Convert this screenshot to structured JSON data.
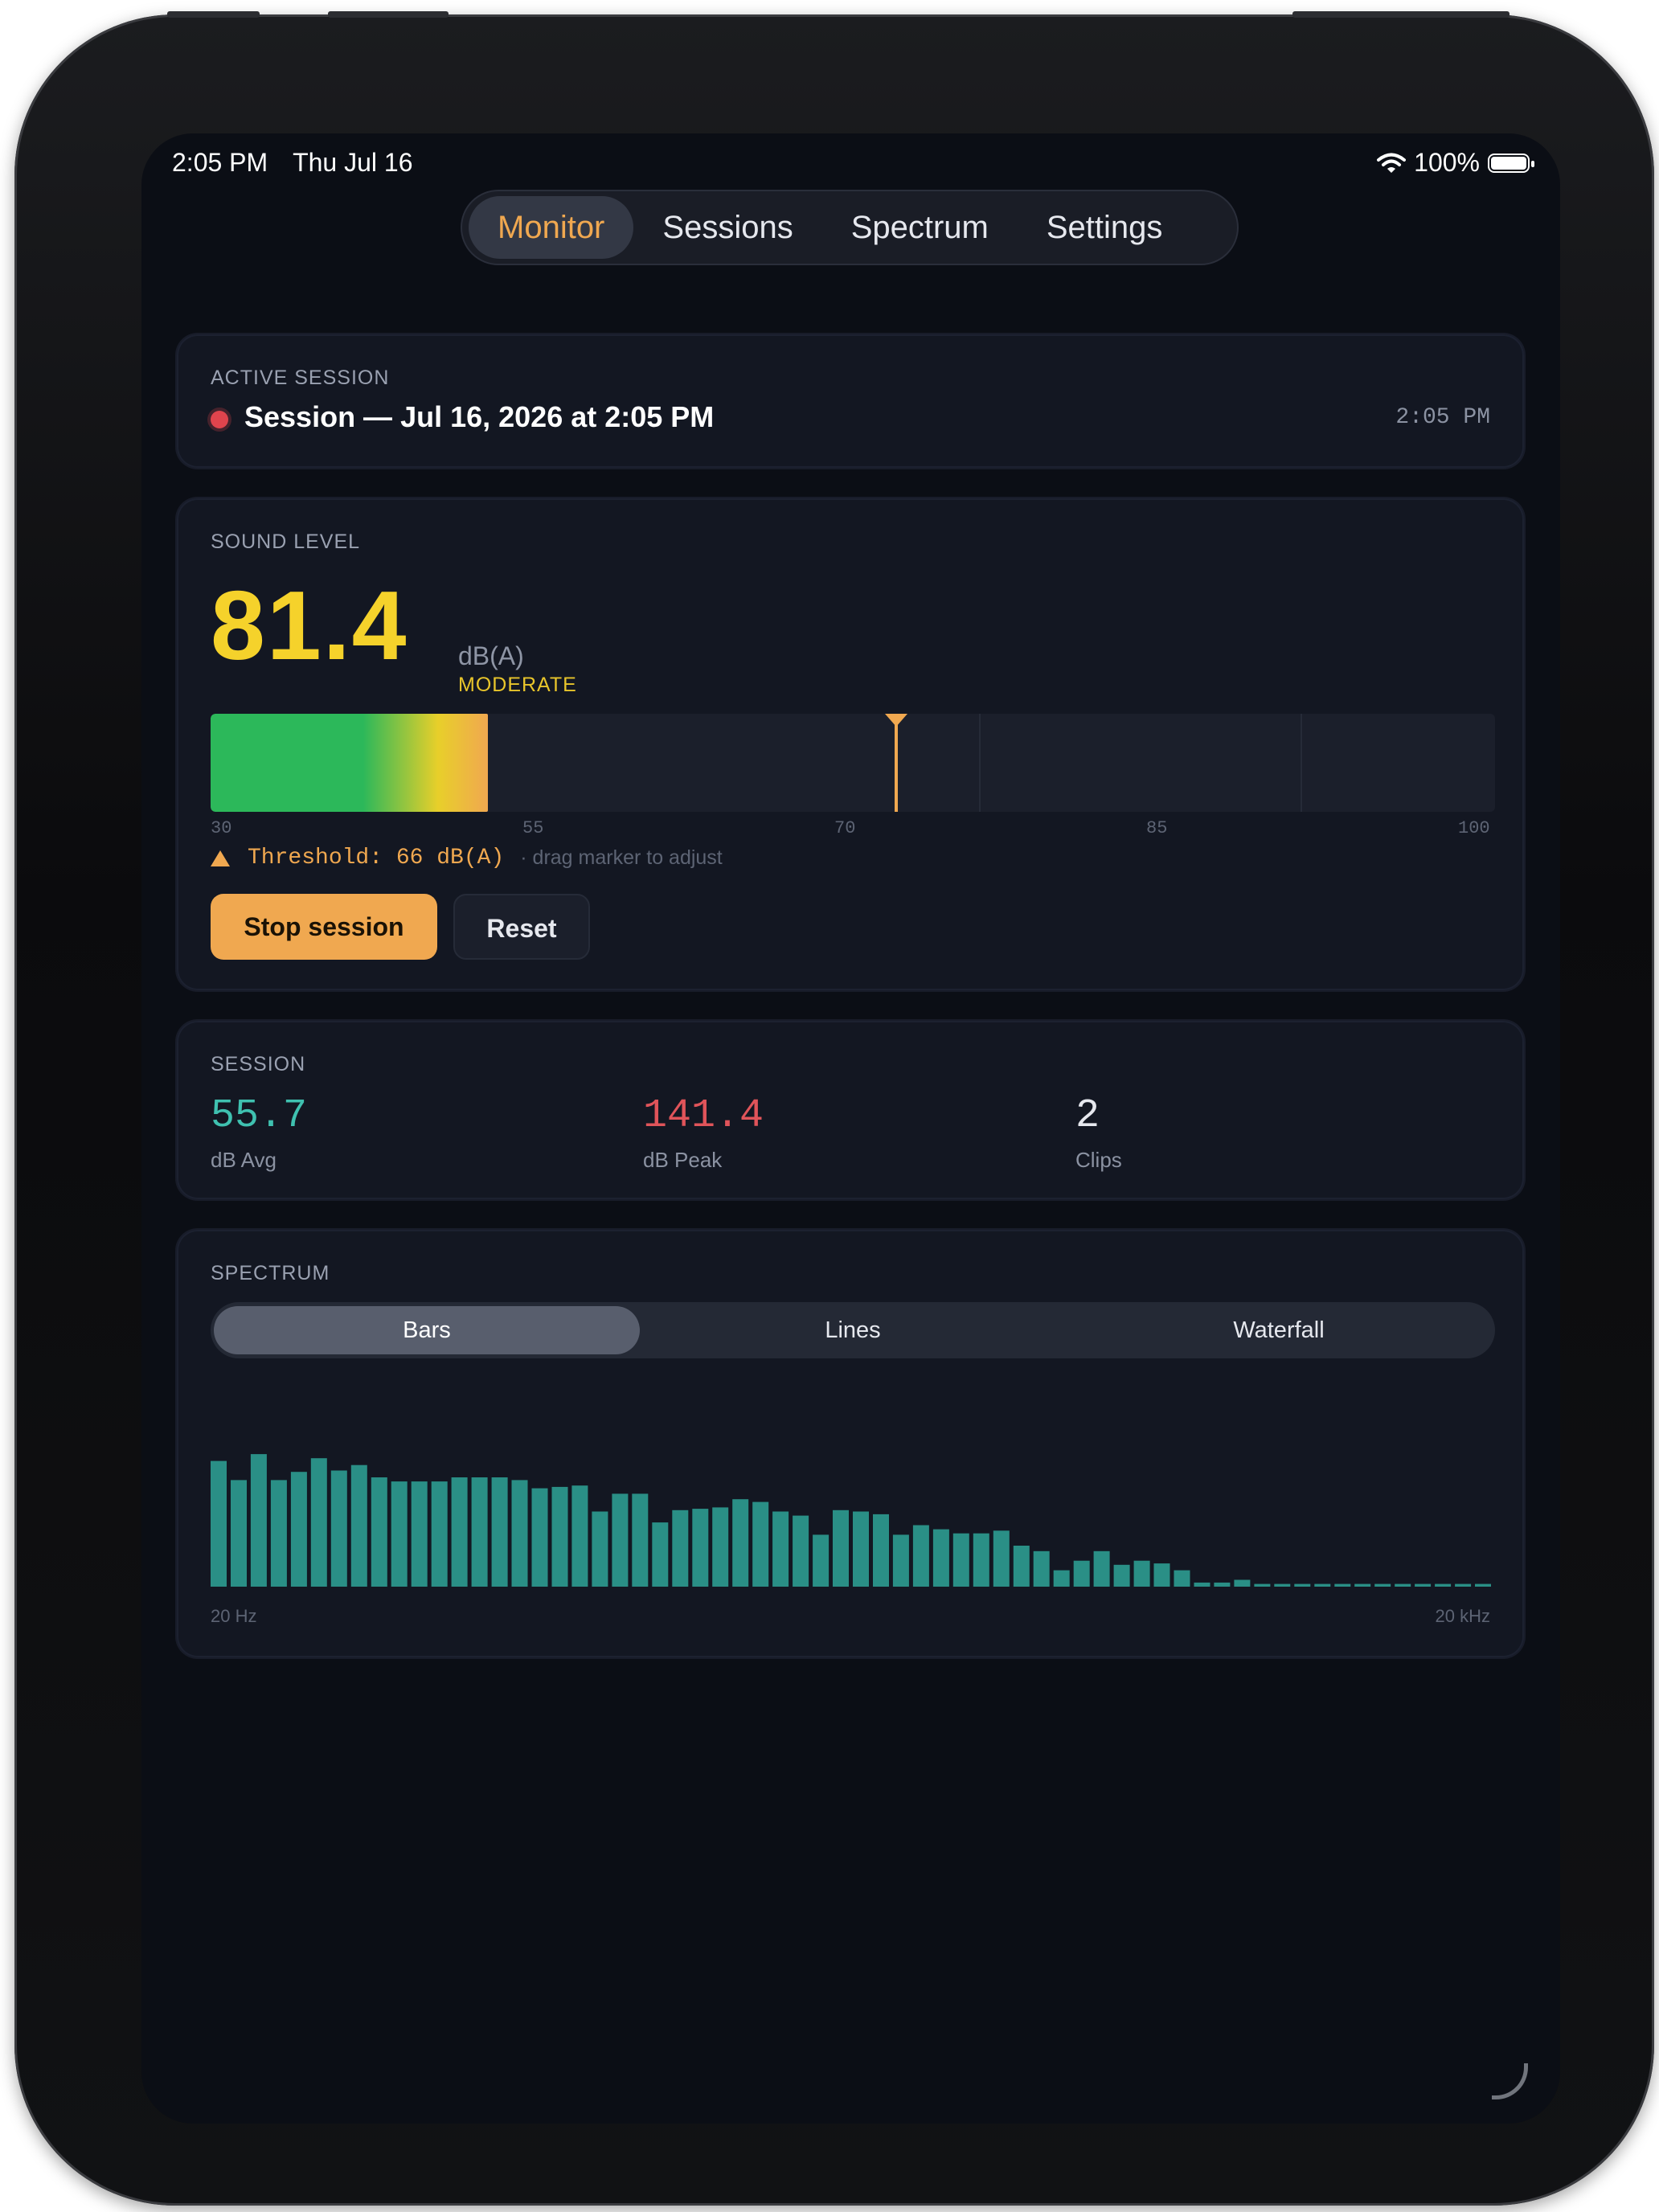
{
  "status_bar": {
    "time": "2:05 PM",
    "date": "Thu Jul 16",
    "battery": "100%"
  },
  "tabs": [
    {
      "label": "Monitor",
      "active": true
    },
    {
      "label": "Sessions",
      "active": false
    },
    {
      "label": "Spectrum",
      "active": false
    },
    {
      "label": "Settings",
      "active": false
    }
  ],
  "active_session": {
    "label": "ACTIVE SESSION",
    "title": "Session — Jul 16, 2026 at 2:05 PM",
    "time": "2:05 PM",
    "recording_color": "#e0444d"
  },
  "sound_level": {
    "label": "SOUND LEVEL",
    "value": "81.4",
    "unit": "dB(A)",
    "status": "MODERATE",
    "meter_fill_fraction": 0.216,
    "threshold_db": 66,
    "threshold_marker_fraction": 0.534,
    "ticks": [
      "30",
      "55",
      "70",
      "85",
      "100"
    ],
    "threshold_text": "Threshold: 66 dB(A)",
    "threshold_hint": "· drag marker to adjust",
    "stop_label": "Stop session",
    "reset_label": "Reset"
  },
  "session_stats": {
    "label": "SESSION",
    "avg_value": "55.7",
    "avg_label": "dB Avg",
    "avg_color": "#3fc1b0",
    "peak_value": "141.4",
    "peak_label": "dB Peak",
    "peak_color": "#e0545a",
    "clips_value": "2",
    "clips_label": "Clips",
    "clips_color": "#e6e8ee"
  },
  "spectrum": {
    "label": "SPECTRUM",
    "modes": [
      {
        "label": "Bars",
        "active": true
      },
      {
        "label": "Lines",
        "active": false
      },
      {
        "label": "Waterfall",
        "active": false
      }
    ],
    "axis_start": "20 Hz",
    "axis_end": "20 kHz",
    "bar_color": "#2a8f86",
    "levels": [
      0.92,
      0.78,
      0.97,
      0.78,
      0.84,
      0.94,
      0.85,
      0.89,
      0.8,
      0.77,
      0.77,
      0.77,
      0.8,
      0.8,
      0.8,
      0.78,
      0.72,
      0.73,
      0.74,
      0.55,
      0.68,
      0.68,
      0.47,
      0.56,
      0.57,
      0.58,
      0.64,
      0.62,
      0.55,
      0.52,
      0.38,
      0.56,
      0.55,
      0.53,
      0.38,
      0.45,
      0.42,
      0.39,
      0.39,
      0.41,
      0.3,
      0.26,
      0.12,
      0.19,
      0.26,
      0.16,
      0.19,
      0.17,
      0.12,
      0.03,
      0.03,
      0.05,
      0.02,
      0.02,
      0.02,
      0.02,
      0.02,
      0.02,
      0.02,
      0.02,
      0.02,
      0.02,
      0.02,
      0.02
    ]
  }
}
